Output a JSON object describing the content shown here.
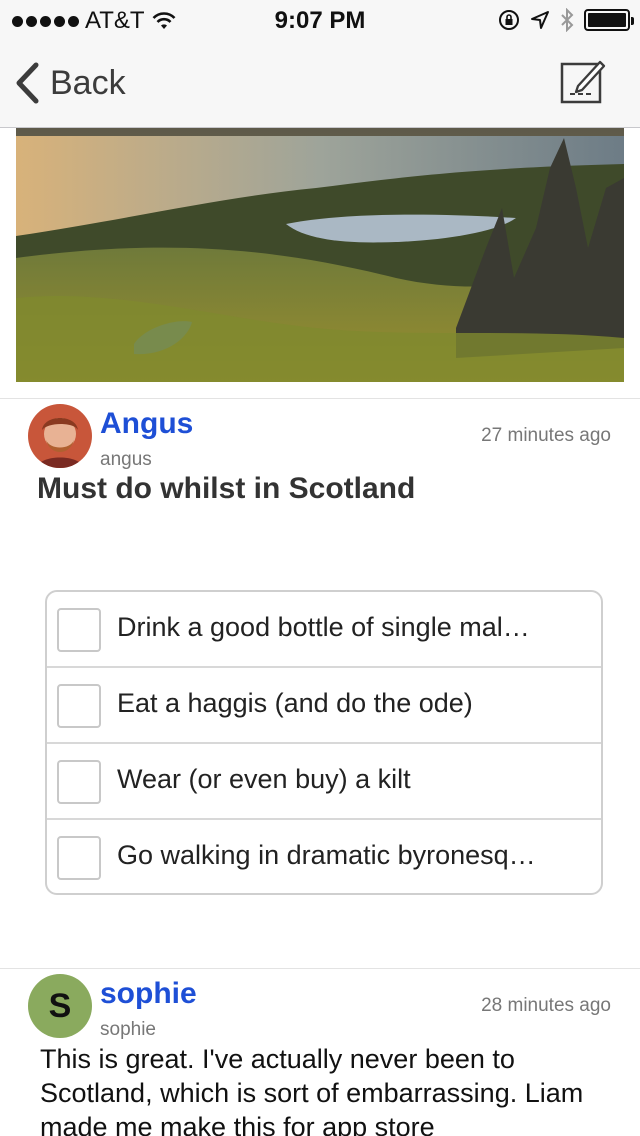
{
  "status_bar": {
    "carrier": "AT&T",
    "time": "9:07 PM",
    "battery_level": 1.0
  },
  "nav": {
    "back_label": "Back",
    "compose_icon": "compose-icon"
  },
  "post": {
    "author_name": "Angus",
    "author_handle": "angus",
    "timestamp": "27 minutes ago",
    "title": "Must do whilst in Scotland",
    "checklist": [
      {
        "text": "Drink a good bottle of single mal…",
        "checked": false
      },
      {
        "text": "Eat a haggis (and do the ode)",
        "checked": false
      },
      {
        "text": "Wear (or even buy) a kilt",
        "checked": false
      },
      {
        "text": "Go walking in dramatic byronesq…",
        "checked": false
      }
    ]
  },
  "comment": {
    "author_initial": "S",
    "author_name": "sophie",
    "author_handle": "sophie",
    "timestamp": "28 minutes ago",
    "text": "This is great. I've actually never been to Scotland, which is sort of embarrassing. Liam made me make this for app store"
  },
  "colors": {
    "link_blue": "#1e4fd6",
    "avatar_green": "#8aaa5e",
    "bar_bg": "#f7f7f7"
  }
}
